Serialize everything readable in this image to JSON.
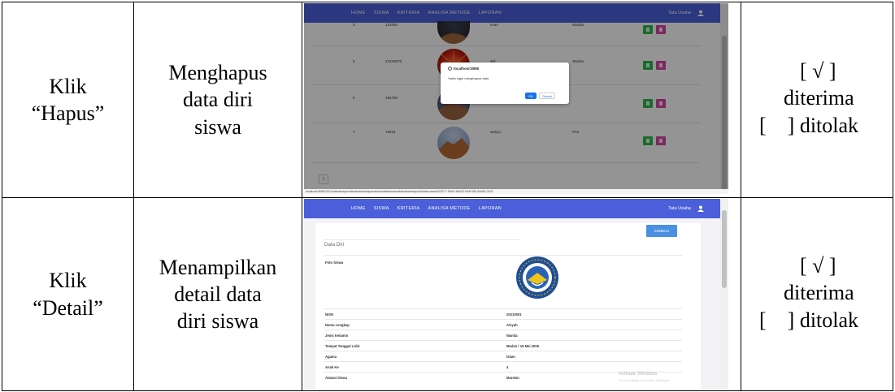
{
  "rows": [
    {
      "action": [
        "Klik",
        "“Hapus”"
      ],
      "description": [
        "Menghapus",
        "data diri",
        "siswa"
      ],
      "status": [
        "[ √ ]",
        "diterima",
        "[    ] ditolak"
      ]
    },
    {
      "action": [
        "Klik",
        "“Detail”"
      ],
      "description": [
        "Menampilkan",
        "detail data",
        "diri siswa"
      ],
      "status": [
        "[ √ ]",
        "diterima",
        "[    ] ditolak"
      ]
    }
  ],
  "app": {
    "nav": [
      "HOME",
      "SISWA",
      "KRITERIA",
      "ANALISA METODE",
      "LAPORAN"
    ],
    "user": "Tata Usaha",
    "colors": {
      "navbar": "#4a5fd9",
      "edit_button": "#2db84d",
      "delete_button": "#d646a3"
    }
  },
  "shot1": {
    "rows": [
      {
        "no": "3",
        "nisn": "123456",
        "nama": "irvan",
        "jk": "Wanita"
      },
      {
        "no": "5",
        "nisn": "22345678",
        "nama": "aliz",
        "jk": "Wanita"
      },
      {
        "no": "6",
        "nisn": "456789",
        "nama": "",
        "jk": ""
      },
      {
        "no": "7",
        "nisn": "78224",
        "nama": "wahyu",
        "jk": "Pria"
      }
    ],
    "dialog": {
      "host": "localhost:8080",
      "message": "Yakin ingin menghapus data",
      "ok": "OK",
      "cancel": "Cancel"
    },
    "page": "1",
    "status_url": "localhost:8080/2021/siswa/hapus/siswa/siswa/hapus/siswa/data/siswa/nilai/siswa/hapus/6/data-siswa/2020   © SMA HANGTUAH BELAWAN 2021"
  },
  "shot2": {
    "back_button": "KEMBALI",
    "section_title": "Data Diri",
    "photo_label": "Foto Siswa",
    "fields": [
      {
        "label": "NISN",
        "value": "20210001"
      },
      {
        "label": "Nama Lengkap",
        "value": "Aisyah"
      },
      {
        "label": "Jenis Kelamin",
        "value": "Wanita"
      },
      {
        "label": "Tempat Tanggal Lahir",
        "value": "Medan / 18 Mei 2005"
      },
      {
        "label": "Agama",
        "value": "Islam"
      },
      {
        "label": "Anak Ke",
        "value": "4"
      },
      {
        "label": "Alamat Siswa",
        "value": "Marelan"
      }
    ],
    "watermark": [
      "Activate Windows",
      "Go to Settings to activate Windows."
    ]
  }
}
